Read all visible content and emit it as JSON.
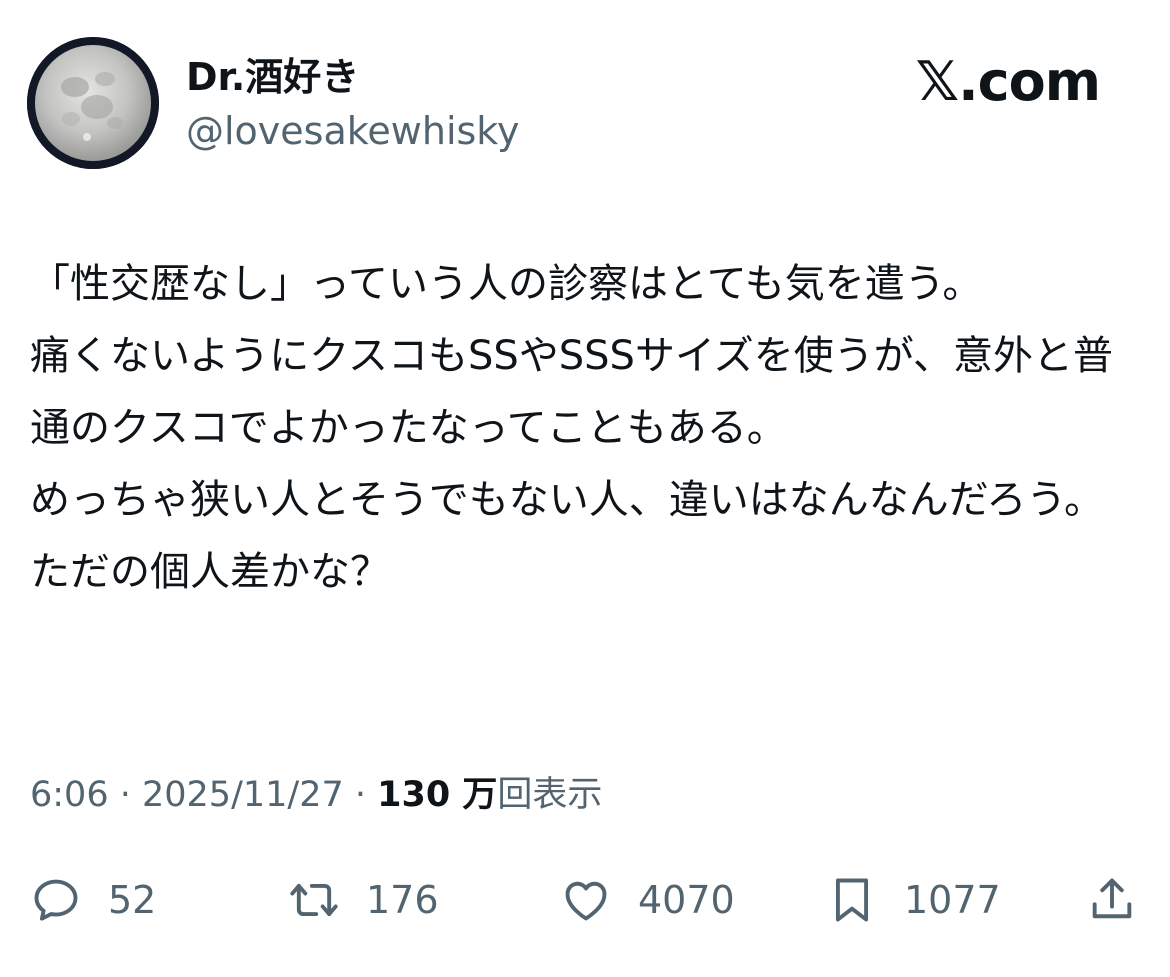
{
  "user": {
    "display_name": "Dr.酒好き",
    "handle": "@lovesakewhisky"
  },
  "brand": "𝕏.com",
  "tweet": {
    "text": "「性交歴なし」っていう人の診察はとても気を遣う。\n痛くないようにクスコもSSやSSSサイズを使うが、意外と普通のクスコでよかったなってこともある。\nめっちゃ狭い人とそうでもない人、違いはなんなんだろう。ただの個人差かな？"
  },
  "meta": {
    "time": "6:06",
    "separator": " · ",
    "date": "2025/11/27",
    "views_count": "130 万",
    "views_label": "回表示"
  },
  "actions": {
    "reply": {
      "icon": "reply-icon",
      "count": "52"
    },
    "retweet": {
      "icon": "retweet-icon",
      "count": "176"
    },
    "like": {
      "icon": "heart-icon",
      "count": "4070"
    },
    "bookmark": {
      "icon": "bookmark-icon",
      "count": "1077"
    },
    "share": {
      "icon": "share-icon"
    }
  },
  "colors": {
    "text_primary": "#0f1419",
    "text_secondary": "#536471"
  }
}
